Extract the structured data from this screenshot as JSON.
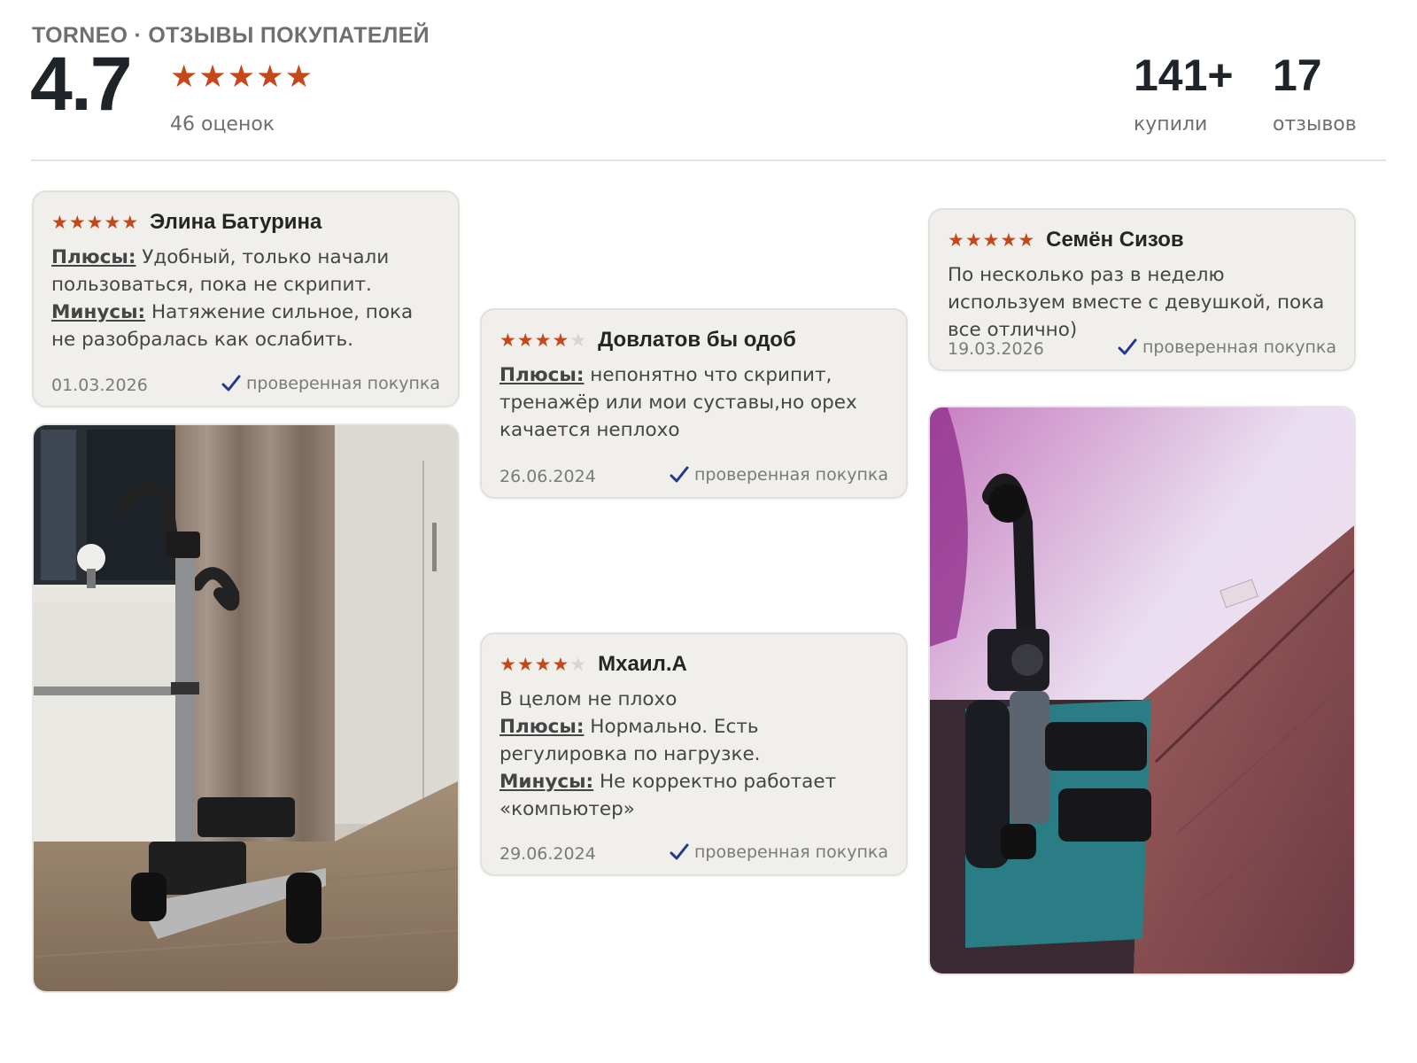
{
  "header": {
    "brand": "TORNEO · ОТЗЫВЫ ПОКУПАТЕЛЕЙ",
    "rating": "4.7",
    "rating_stars": 5,
    "rating_count": "46 оценок",
    "stats": [
      {
        "value": "141+",
        "label": "купили"
      },
      {
        "value": "17",
        "label": "отзывов"
      }
    ]
  },
  "reviews": [
    {
      "author": "Элина Батурина",
      "stars": 5,
      "pros_label": "Плюсы:",
      "pros": "Удобный, только начали пользоваться, пока не скрипит.",
      "cons_label": "Минусы:",
      "cons": "Натяжение сильное, пока не разобралась как ослабить.",
      "date": "01.03.2026",
      "verified": "проверенная покупка"
    },
    {
      "author": "Довлатов бы одоб",
      "stars": 4,
      "pros_label": "Плюсы:",
      "pros": "непонятно что скрипит, тренажёр или мои суставы,но орех качается неплохо",
      "date": "26.06.2024",
      "verified": "проверенная покупка"
    },
    {
      "author": "Мхаил.А",
      "stars": 4,
      "text": "В целом не плохо",
      "pros_label": "Плюсы:",
      "pros": "Нормально. Есть регулировка по нагрузке.",
      "cons_label": "Минусы:",
      "cons": "Не корректно работает «компьютер»",
      "date": "29.06.2024",
      "verified": "проверенная покупка"
    },
    {
      "author": "Семён Сизов",
      "stars": 5,
      "text": "По несколько раз в неделю используем вместе с девушкой, пока все отлично)",
      "date": "19.03.2026",
      "verified": "проверенная покупка"
    }
  ],
  "colors": {
    "star": "#c4481a",
    "star_off": "#d9d6d1",
    "card_bg": "#f1efeb",
    "check": "#1f3a8a"
  },
  "icons": {
    "star": "star-icon",
    "verified": "check-icon"
  }
}
